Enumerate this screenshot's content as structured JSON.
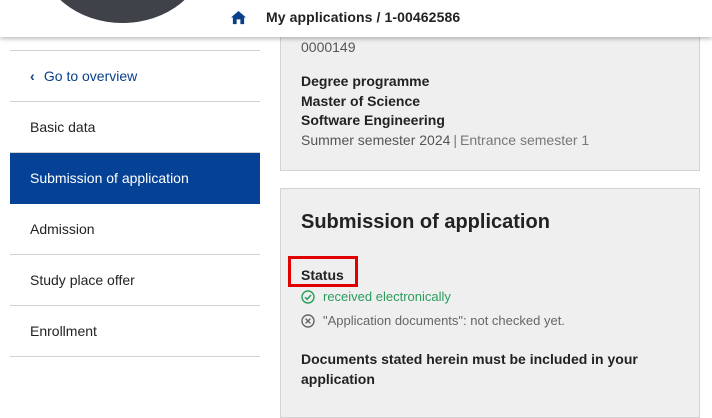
{
  "header": {
    "breadcrumb": "My applications / 1-00462586",
    "home_icon": "home-icon"
  },
  "sidebar": {
    "overview_label": "Go to overview",
    "items": [
      {
        "label": "Basic data"
      },
      {
        "label": "Submission of application",
        "active": true
      },
      {
        "label": "Admission"
      },
      {
        "label": "Study place offer"
      },
      {
        "label": "Enrollment"
      }
    ]
  },
  "application_info": {
    "number": "0000149",
    "programme_heading": "Degree programme",
    "degree": "Master of Science",
    "subject": "Software Engineering",
    "semester": "Summer semester 2024",
    "separator": "|",
    "entrance_semester": "Entrance semester 1"
  },
  "submission": {
    "title": "Submission of application",
    "status_label": "Status",
    "status_items": [
      {
        "text": "received electronically",
        "icon": "check-circle-icon",
        "color": "#2a9d5c"
      },
      {
        "text": "\"Application documents\": not checked yet.",
        "icon": "x-circle-icon",
        "color": "#666666"
      }
    ],
    "documents_text": "Documents stated herein must be included in your application"
  },
  "colors": {
    "primary": "#054296",
    "highlight": "#e00000",
    "success": "#2a9d5c"
  }
}
